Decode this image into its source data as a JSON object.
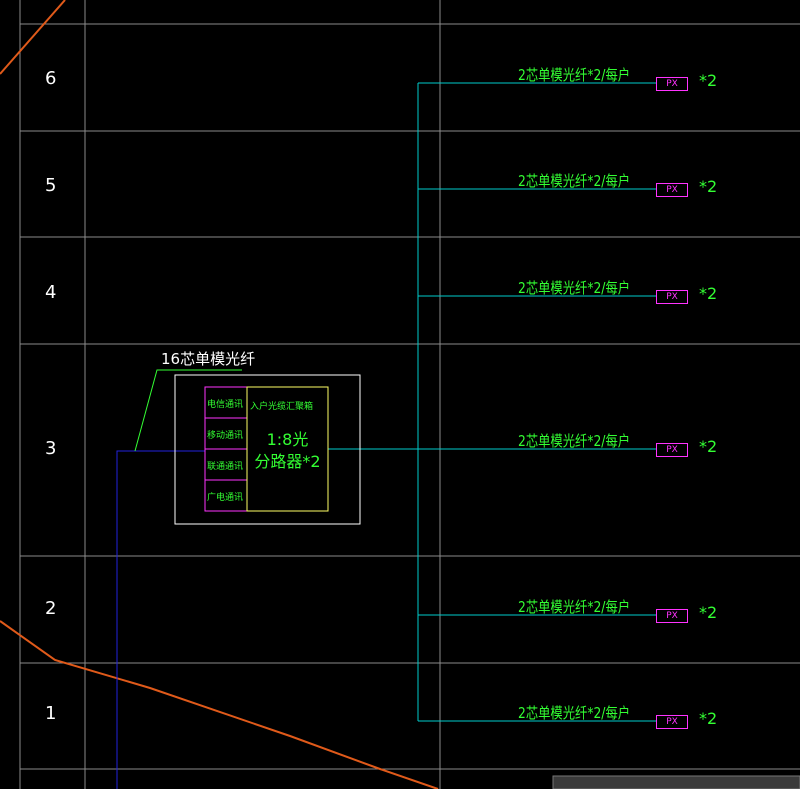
{
  "floors": [
    "6",
    "5",
    "4",
    "3",
    "2",
    "1"
  ],
  "branches": [
    {
      "label": "2芯单模光纤*2/每户",
      "terminal": "PX",
      "multiplier": "*2"
    },
    {
      "label": "2芯单模光纤*2/每户",
      "terminal": "PX",
      "multiplier": "*2"
    },
    {
      "label": "2芯单模光纤*2/每户",
      "terminal": "PX",
      "multiplier": "*2"
    },
    {
      "label": "2芯单模光纤*2/每户",
      "terminal": "PX",
      "multiplier": "*2"
    },
    {
      "label": "2芯单模光纤*2/每户",
      "terminal": "PX",
      "multiplier": "*2"
    },
    {
      "label": "2芯单模光纤*2/每户",
      "terminal": "PX",
      "multiplier": "*2"
    }
  ],
  "incoming_cable_label": "16芯单模光纤",
  "box": {
    "title": "入户光缆汇聚箱",
    "operators": [
      "电信通讯",
      "移动通讯",
      "联通通讯",
      "广电通讯"
    ],
    "splitter_line1": "1:8光",
    "splitter_line2": "分路器*2"
  },
  "colors": {
    "background": "#000000",
    "grid": "#8a8a8a",
    "riser": "#00cccc",
    "text_green": "#33ff33",
    "magenta": "#ff33ff",
    "box_border": "#ffffff",
    "splitter_border": "#ffff66",
    "feed_line": "#2222dd",
    "boundary": "#e05a1a"
  }
}
